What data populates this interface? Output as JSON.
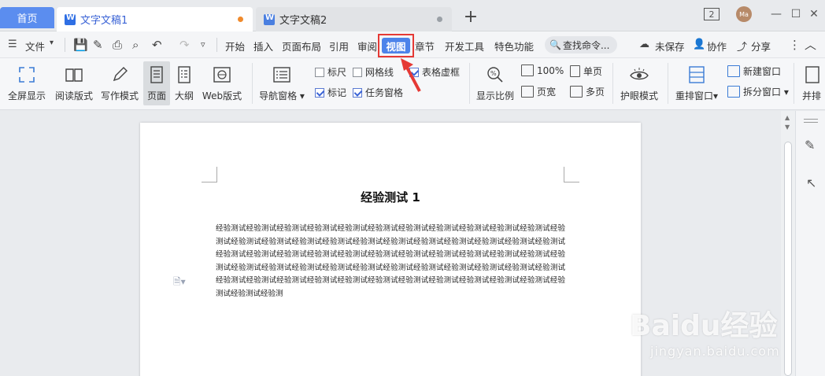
{
  "tabs": {
    "home": "首页",
    "doc1": "文字文稿1",
    "doc2": "文字文稿2",
    "badge": "2",
    "avatar": "Ma"
  },
  "menu": {
    "file": "文件",
    "items": [
      "开始",
      "插入",
      "页面布局",
      "引用",
      "审阅",
      "视图",
      "章节",
      "开发工具",
      "特色功能"
    ],
    "search": "查找命令...",
    "unsaved": "未保存",
    "collab": "协作",
    "share": "分享"
  },
  "ribbon": {
    "fullscreen": "全屏显示",
    "reading": "阅读版式",
    "writing": "写作模式",
    "page": "页面",
    "outline": "大纲",
    "web": "Web版式",
    "navpane": "导航窗格",
    "ruler": "标尺",
    "gridlines": "网格线",
    "tablegrid": "表格虚框",
    "marks": "标记",
    "taskpane": "任务窗格",
    "zoom": "显示比例",
    "zoom100": "100%",
    "pagewidth": "页宽",
    "singlepage": "单页",
    "multipage": "多页",
    "eyecare": "护眼模式",
    "rearrange": "重排窗口",
    "newwindow": "新建窗口",
    "splitwindow": "拆分窗口",
    "more": "并排"
  },
  "document": {
    "title": "经验测试 1",
    "body": "经验测试经验测试经验测试经验测试经验测试经验测试经验测试经验测试经验测试经验测试经验测试经验测试经验测试经验测试经验测试经验测试经验测试经验测试经验测试经验测试经验测试经验测试经验测试经验测试经验测试经验测试经验测试经验测试经验测试经验测试经验测试经验测试经验测试经验测试经验测试经验测试经验测试经验测试经验测试经验测试经验测试经验测试经验测试经验测试经验测试经验测试经验测试经验测试经验测试经验测试经验测试经验测试经验测试经验测试经验测试经验测试经验测试经验测试经验测试经验测"
  },
  "watermark": {
    "brand": "Baidu经验",
    "url": "jingyan.baidu.com"
  },
  "colors": {
    "accent": "#4c83ea",
    "highlight": "#e53935"
  }
}
